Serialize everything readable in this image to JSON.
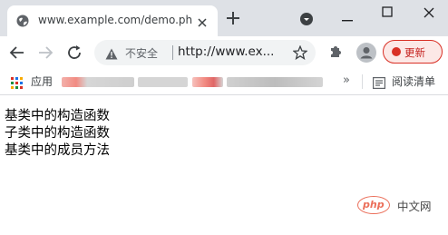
{
  "browser": {
    "tab": {
      "title": "www.example.com/demo.php"
    },
    "omnibox": {
      "security_label": "不安全",
      "url": "http://www.ex..."
    },
    "update_label": "更新",
    "bookmarks": {
      "apps_label": "应用",
      "more_glyph": "»",
      "reading_list_label": "阅读清单"
    }
  },
  "page": {
    "lines": [
      "基类中的构造函数",
      "子类中的构造函数",
      "基类中的成员方法"
    ]
  },
  "watermark": {
    "logo_text": "php",
    "site_text": "中文网"
  },
  "colors": {
    "tabbar_bg": "#dee1e6",
    "update_accent": "#d93025",
    "php_orange": "#eb6f5a"
  }
}
